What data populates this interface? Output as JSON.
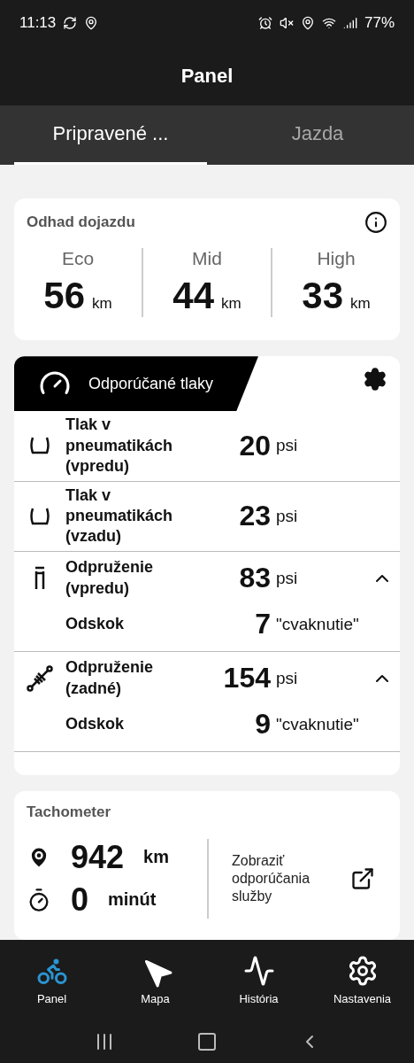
{
  "status_bar": {
    "time": "11:13",
    "battery": "77%"
  },
  "header": {
    "title": "Panel"
  },
  "tabs": [
    {
      "label": "Pripravené ...",
      "selected": true
    },
    {
      "label": "Jazda",
      "selected": false
    }
  ],
  "range_card": {
    "title": "Odhad dojazdu",
    "modes": [
      {
        "label": "Eco",
        "value": "56",
        "unit": "km"
      },
      {
        "label": "Mid",
        "value": "44",
        "unit": "km"
      },
      {
        "label": "High",
        "value": "33",
        "unit": "km"
      }
    ]
  },
  "pressure_card": {
    "title": "Odporúčané tlaky",
    "rows": [
      {
        "kind": "tire",
        "label": "Tlak v pneumatikách (vpredu)",
        "value": "20",
        "unit": "psi"
      },
      {
        "kind": "tire",
        "label": "Tlak v pneumatikách (vzadu)",
        "value": "23",
        "unit": "psi"
      },
      {
        "kind": "fork",
        "label": "Odpruženie (vpredu)",
        "value": "83",
        "unit": "psi",
        "expanded": true,
        "sub": {
          "label": "Odskok",
          "value": "7",
          "unit": "\"cvaknutie\""
        }
      },
      {
        "kind": "shock",
        "label": "Odpruženie (zadné)",
        "value": "154",
        "unit": "psi",
        "expanded": true,
        "sub": {
          "label": "Odskok",
          "value": "9",
          "unit": "\"cvaknutie\""
        }
      }
    ]
  },
  "odometer_card": {
    "title": "Tachometer",
    "distance": {
      "value": "942",
      "unit": "km"
    },
    "time": {
      "value": "0",
      "unit": "minút"
    },
    "service_link": "Zobraziť odporúčania služby"
  },
  "bottom_nav": [
    {
      "kind": "bike",
      "label": "Panel",
      "selected": true
    },
    {
      "kind": "map",
      "label": "Mapa",
      "selected": false
    },
    {
      "kind": "history",
      "label": "História",
      "selected": false
    },
    {
      "kind": "settings",
      "label": "Nastavenia",
      "selected": false
    }
  ]
}
